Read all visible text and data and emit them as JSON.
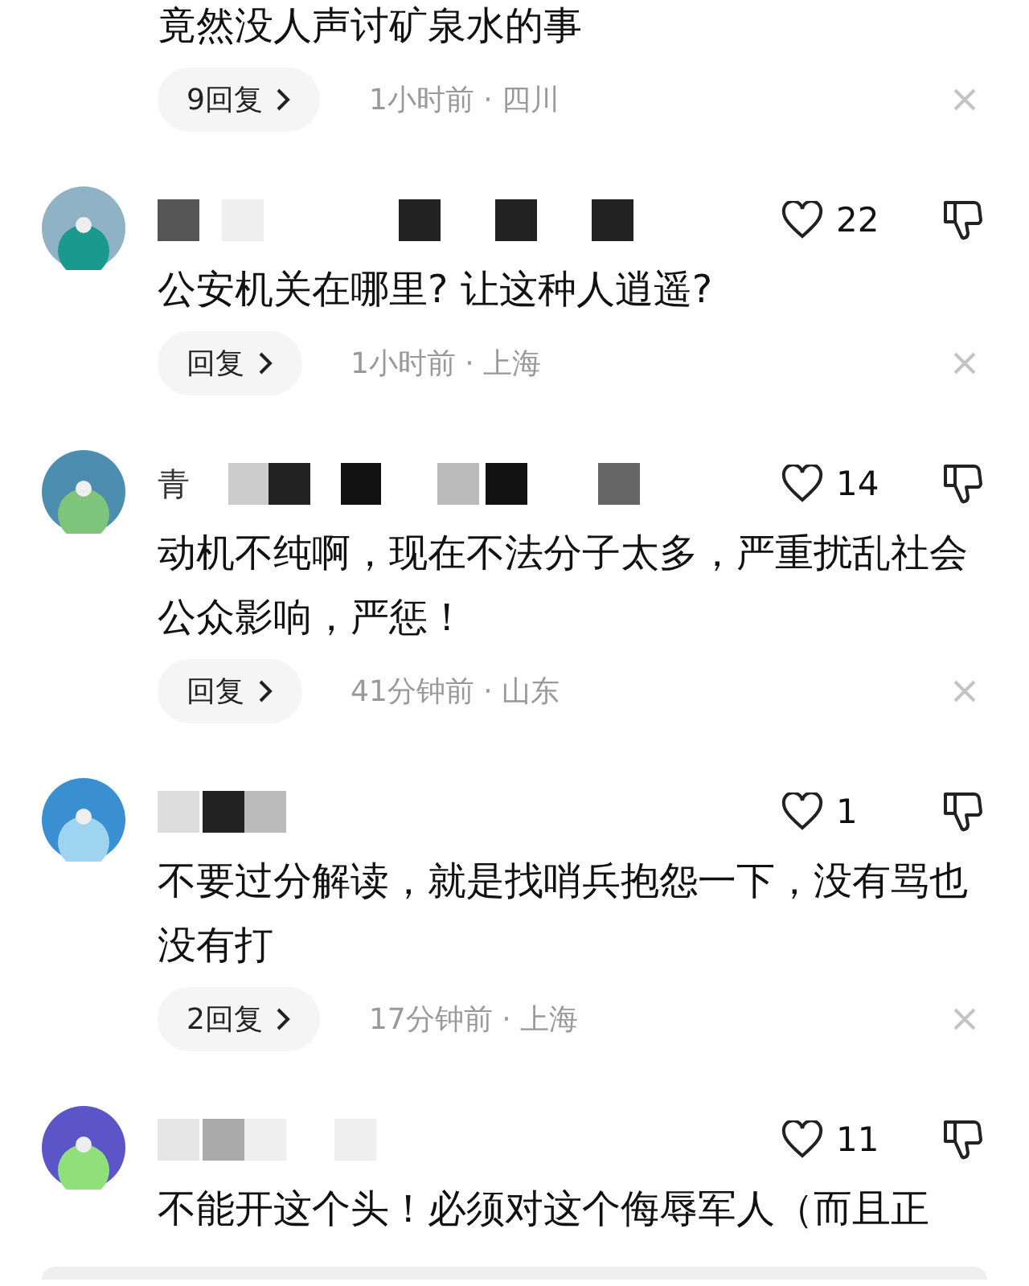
{
  "comments": [
    {
      "kind": "continued",
      "text": "竟然没人声讨矿泉水的事",
      "reply": "9回复",
      "meta": "1小时前 · 四川"
    },
    {
      "kind": "comment",
      "likes": "22",
      "text": "公安机关在哪里? 让这种人逍遥?",
      "reply": "回复",
      "meta": "1小时前 · 上海"
    },
    {
      "kind": "comment",
      "name_fragment": "青",
      "likes": "14",
      "text": "动机不纯啊，现在不法分子太多，严重扰乱社会公众影响，严惩！",
      "reply": "回复",
      "meta": "41分钟前 · 山东"
    },
    {
      "kind": "comment",
      "likes": "1",
      "text": "不要过分解读，就是找哨兵抱怨一下，没有骂也没有打",
      "reply": "2回复",
      "meta": "17分钟前 · 上海"
    },
    {
      "kind": "comment",
      "likes": "11",
      "text": "不能开这个头！必须对这个侮辱军人（而且正"
    }
  ]
}
